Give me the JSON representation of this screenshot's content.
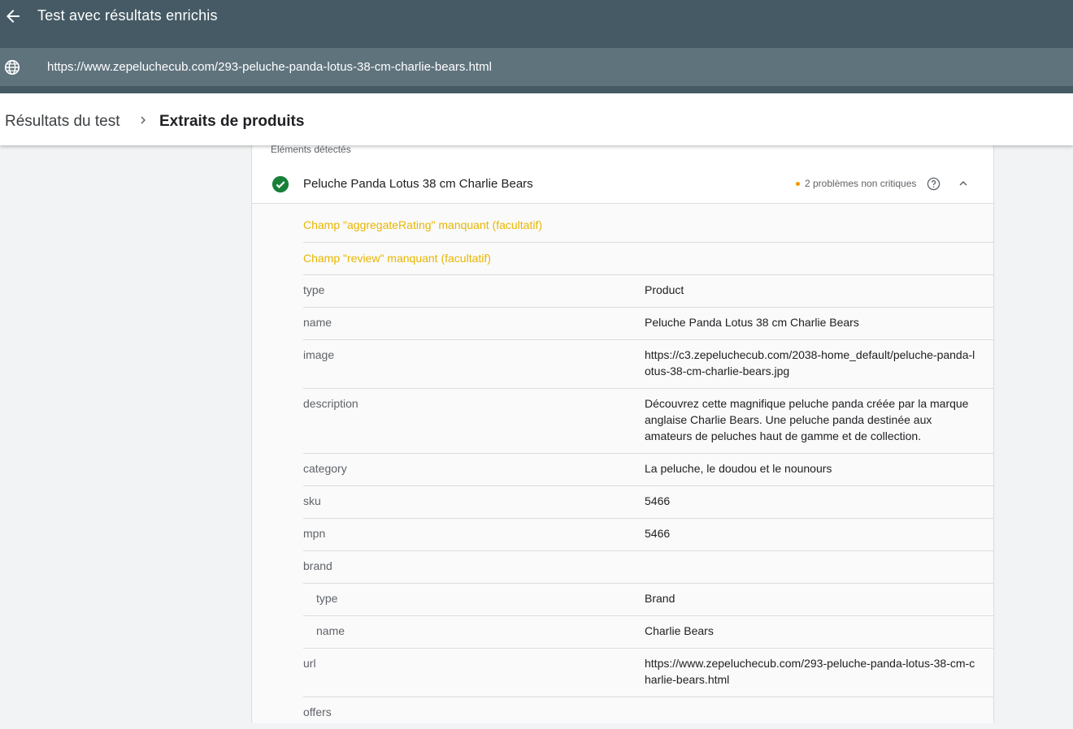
{
  "header": {
    "title": "Test avec résultats enrichis",
    "back_icon": "arrow-back-icon"
  },
  "url_bar": {
    "globe_icon": "globe-icon",
    "url": "https://www.zepeluchecub.com/293-peluche-panda-lotus-38-cm-charlie-bears.html"
  },
  "breadcrumb": {
    "parent": "Résultats du test",
    "current": "Extraits de produits",
    "separator_icon": "chevron-right-icon"
  },
  "section": {
    "label": "Éléments détectés"
  },
  "item": {
    "title": "Peluche Panda Lotus 38 cm Charlie Bears",
    "status_icon": "check-circle-icon",
    "issues": "2 problèmes non critiques",
    "issue_color": "#f29900",
    "valid_color": "#188038"
  },
  "warnings": [
    "Champ \"aggregateRating\" manquant (facultatif)",
    "Champ \"review\" manquant (facultatif)"
  ],
  "fields": [
    {
      "key": "type",
      "value": "Product"
    },
    {
      "key": "name",
      "value": "Peluche Panda Lotus 38 cm Charlie Bears"
    },
    {
      "key": "image",
      "value": "https://c3.zepeluchecub.com/2038-home_default/peluche-panda-lotus-38-cm-charlie-bears.jpg"
    },
    {
      "key": "description",
      "value": "Découvrez cette magnifique peluche panda créée par la marque anglaise Charlie Bears. Une peluche panda destinée aux amateurs de peluches haut de gamme et de collection."
    },
    {
      "key": "category",
      "value": "La peluche, le doudou et le nounours"
    },
    {
      "key": "sku",
      "value": "5466"
    },
    {
      "key": "mpn",
      "value": "5466"
    },
    {
      "key": "brand",
      "value": ""
    },
    {
      "key": "type",
      "value": "Brand"
    },
    {
      "key": "name",
      "value": "Charlie Bears"
    },
    {
      "key": "url",
      "value": "https://www.zepeluchecub.com/293-peluche-panda-lotus-38-cm-charlie-bears.html"
    },
    {
      "key": "offers",
      "value": ""
    }
  ]
}
